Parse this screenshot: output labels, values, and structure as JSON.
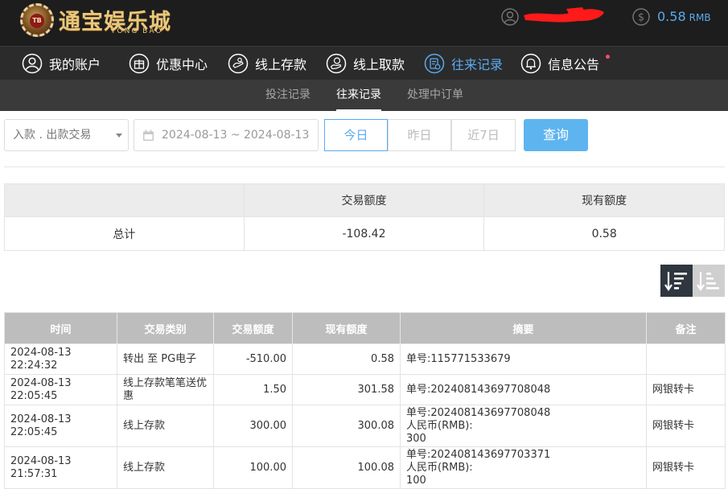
{
  "header": {
    "logo_badge": "TB",
    "logo_title": "通宝娱乐城",
    "logo_subtitle": "TONG BAO",
    "balance": "0.58",
    "currency": "RMB"
  },
  "nav": {
    "items": [
      {
        "label": "我的账户",
        "icon": "user-circle-icon"
      },
      {
        "label": "优惠中心",
        "icon": "gift-icon"
      },
      {
        "label": "线上存款",
        "icon": "deposit-icon"
      },
      {
        "label": "线上取款",
        "icon": "withdraw-icon"
      },
      {
        "label": "往来记录",
        "icon": "records-icon",
        "active": true
      },
      {
        "label": "信息公告",
        "icon": "bell-icon"
      }
    ]
  },
  "subnav": {
    "items": [
      {
        "label": "投注记录"
      },
      {
        "label": "往来记录",
        "active": true
      },
      {
        "label": "处理中订单"
      }
    ]
  },
  "filter": {
    "type_selected": "入款 . 出款交易",
    "date_range": "2024-08-13 ~ 2024-08-13",
    "quick": [
      "今日",
      "昨日",
      "近7日"
    ],
    "quick_active": "今日",
    "query_label": "查询"
  },
  "summary": {
    "headers": [
      "",
      "交易额度",
      "现有额度"
    ],
    "row_label": "总计",
    "amount": "-108.42",
    "balance": "0.58"
  },
  "sort": {
    "active": "descending"
  },
  "records": {
    "headers": [
      "时间",
      "交易类别",
      "交易额度",
      "现有额度",
      "摘要",
      "备注"
    ],
    "rows": [
      {
        "time": "2024-08-13 22:24:32",
        "category": "转出 至 PG电子",
        "amount": "-510.00",
        "balance": "0.58",
        "summary": [
          "单号:115771533679"
        ],
        "note": ""
      },
      {
        "time": "2024-08-13 22:05:45",
        "category": "线上存款笔笔送优惠",
        "amount": "1.50",
        "balance": "301.58",
        "summary": [
          "单号:202408143697708048"
        ],
        "note": "网银转卡"
      },
      {
        "time": "2024-08-13 22:05:45",
        "category": "线上存款",
        "amount": "300.00",
        "balance": "300.08",
        "summary": [
          "单号:202408143697708048",
          "人民币(RMB):",
          "300"
        ],
        "note": "网银转卡"
      },
      {
        "time": "2024-08-13 21:57:31",
        "category": "线上存款",
        "amount": "100.00",
        "balance": "100.08",
        "summary": [
          "单号:202408143697703371",
          "人民币(RMB):",
          "100"
        ],
        "note": "网银转卡"
      }
    ]
  },
  "colors": {
    "accent": "#5aaaf0",
    "topbar": "#1d1d1d",
    "nav": "#2b2b2b",
    "subnav": "#3a3a3a",
    "redaction": "#ff1a1a"
  }
}
